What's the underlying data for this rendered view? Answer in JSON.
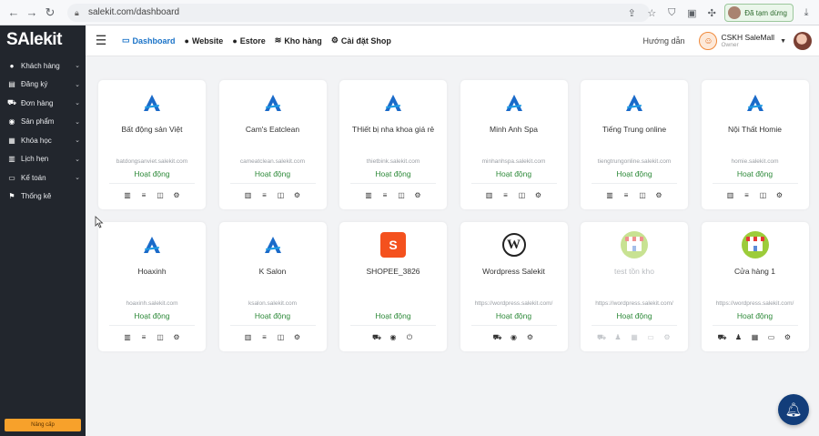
{
  "browser": {
    "url": "salekit.com/dashboard",
    "profile_label": "Đã tạm dừng"
  },
  "sidebar": {
    "logo": "SAlekit",
    "items": [
      {
        "label": "Khách hàng",
        "icon": "user-icon",
        "has_children": true
      },
      {
        "label": "Đăng ký",
        "icon": "register-icon",
        "has_children": true
      },
      {
        "label": "Đơn hàng",
        "icon": "cart-icon",
        "has_children": true
      },
      {
        "label": "Sản phẩm",
        "icon": "product-icon",
        "has_children": true
      },
      {
        "label": "Khóa học",
        "icon": "course-icon",
        "has_children": true
      },
      {
        "label": "Lịch hẹn",
        "icon": "calendar-icon",
        "has_children": true
      },
      {
        "label": "Kế toán",
        "icon": "accounting-icon",
        "has_children": true
      },
      {
        "label": "Thống kê",
        "icon": "flag-icon",
        "has_children": false
      }
    ],
    "upgrade_label": "Nâng cấp"
  },
  "topnav": {
    "items": [
      {
        "label": "Dashboard",
        "icon": "monitor-icon",
        "active": true
      },
      {
        "label": "Website",
        "icon": "globe-icon",
        "active": false
      },
      {
        "label": "Estore",
        "icon": "globe-icon",
        "active": false
      },
      {
        "label": "Kho hàng",
        "icon": "layers-icon",
        "active": false
      },
      {
        "label": "Cài đặt Shop",
        "icon": "gear-icon",
        "active": false
      }
    ],
    "guide": "Hướng dẫn",
    "user_name": "CSKH SaleMall",
    "user_role": "Owner"
  },
  "shops": [
    {
      "name": "Bất động sản Việt",
      "domain": "batdongsanviet.salekit.com",
      "status": "Hoạt động",
      "logo": "salekit-a",
      "actions": [
        "barcode-icon",
        "list-icon",
        "layout-icon",
        "gear-icon"
      ]
    },
    {
      "name": "Cam's Eatclean",
      "domain": "cameatclean.salekit.com",
      "status": "Hoạt động",
      "logo": "salekit-a",
      "actions": [
        "barcode-icon",
        "list-icon",
        "layout-icon",
        "gear-icon"
      ]
    },
    {
      "name": "THiết bị nha khoa giá rẻ",
      "domain": "thietbink.salekit.com",
      "status": "Hoạt động",
      "logo": "salekit-a",
      "actions": [
        "barcode-icon",
        "list-icon",
        "layout-icon",
        "gear-icon"
      ]
    },
    {
      "name": "Minh Anh Spa",
      "domain": "minhanhspa.salekit.com",
      "status": "Hoạt động",
      "logo": "salekit-a",
      "actions": [
        "barcode-icon",
        "list-icon",
        "layout-icon",
        "gear-icon"
      ]
    },
    {
      "name": "Tiếng Trung online",
      "domain": "tiengtrungonline.salekit.com",
      "status": "Hoạt động",
      "logo": "salekit-a",
      "actions": [
        "barcode-icon",
        "list-icon",
        "layout-icon",
        "gear-icon"
      ]
    },
    {
      "name": "Nội Thất Homie",
      "domain": "homie.salekit.com",
      "status": "Hoạt động",
      "logo": "salekit-a",
      "actions": [
        "barcode-icon",
        "list-icon",
        "layout-icon",
        "gear-icon"
      ]
    },
    {
      "name": "Hoaxinh",
      "domain": "hoaxinh.salekit.com",
      "status": "Hoạt động",
      "logo": "salekit-a",
      "actions": [
        "barcode-icon",
        "list-icon",
        "layout-icon",
        "gear-icon"
      ]
    },
    {
      "name": "K Salon",
      "domain": "ksalon.salekit.com",
      "status": "Hoạt động",
      "logo": "salekit-a",
      "actions": [
        "barcode-icon",
        "list-icon",
        "layout-icon",
        "gear-icon"
      ]
    },
    {
      "name": "SHOPEE_3826",
      "domain": "",
      "status": "Hoạt động",
      "logo": "shopee",
      "actions": [
        "cart-icon",
        "compass-icon",
        "power-icon"
      ]
    },
    {
      "name": "Wordpress Salekit",
      "domain": "https://wordpress.salekit.com/",
      "status": "Hoạt động",
      "logo": "wordpress",
      "actions": [
        "cart-icon",
        "compass-icon",
        "gear-icon"
      ]
    },
    {
      "name": "test tồn kho",
      "domain": "https://wordpress.salekit.com/",
      "status": "Hoạt động",
      "logo": "store",
      "muted": true,
      "actions": [
        "cart-icon",
        "user-icon",
        "calendar-icon",
        "card-icon",
        "gear-icon"
      ]
    },
    {
      "name": "Cửa hàng 1",
      "domain": "https://wordpress.salekit.com/",
      "status": "Hoạt động",
      "logo": "store",
      "actions": [
        "cart-icon",
        "user-icon",
        "calendar-icon",
        "card-icon",
        "gear-icon"
      ]
    }
  ],
  "colors": {
    "sidebar_bg": "#22262d",
    "active_nav": "#1a73c8",
    "status_green": "#2e8a3a",
    "brand_blue": "#1a6ac9",
    "chat_bg": "#123d7a"
  }
}
